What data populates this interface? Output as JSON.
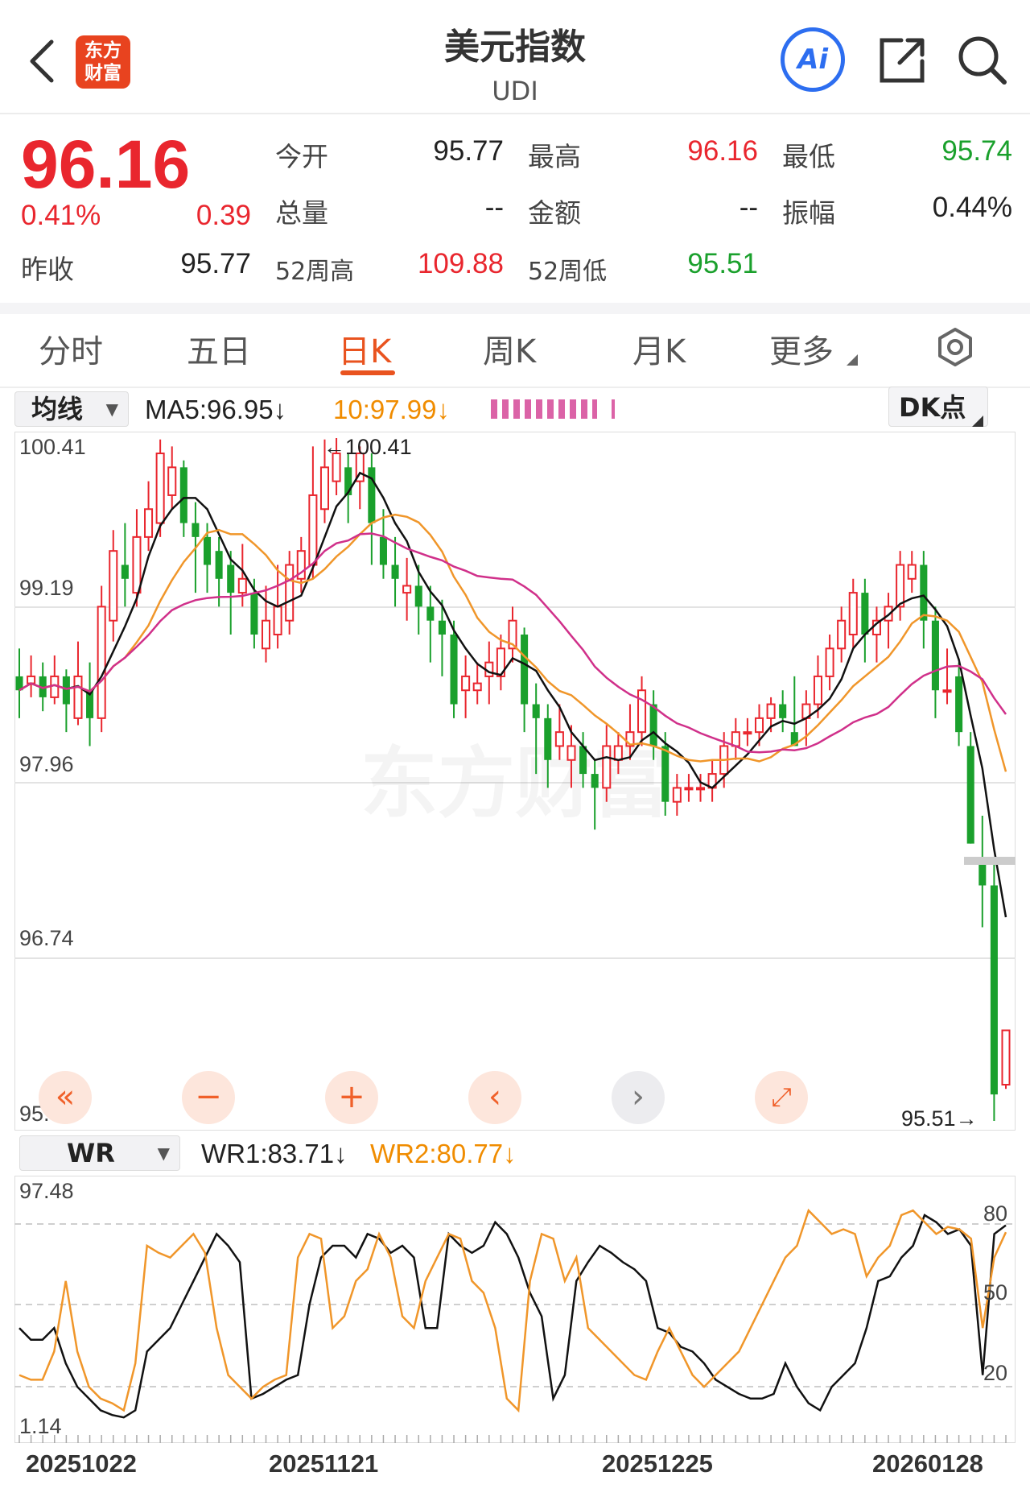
{
  "header": {
    "title": "美元指数",
    "subtitle": "UDI",
    "logo_text_1": "东方",
    "logo_text_2": "财富",
    "ai_label": "Ai"
  },
  "quote": {
    "price": "96.16",
    "change_pct": "0.41%",
    "change": "0.39",
    "prev_close_label": "昨收",
    "prev_close": "95.77",
    "open_label": "今开",
    "open": "95.77",
    "high_label": "最高",
    "high": "96.16",
    "low_label": "最低",
    "low": "95.74",
    "volume_label": "总量",
    "volume": "--",
    "amount_label": "金额",
    "amount": "--",
    "amplitude_label": "振幅",
    "amplitude": "0.44%",
    "w52_high_label": "52周高",
    "w52_high": "109.88",
    "w52_low_label": "52周低",
    "w52_low": "95.51"
  },
  "tabs": [
    {
      "label": "分时"
    },
    {
      "label": "五日"
    },
    {
      "label": "日K"
    },
    {
      "label": "周K"
    },
    {
      "label": "月K"
    },
    {
      "label": "更多"
    }
  ],
  "main_indicator": {
    "selector": "均线",
    "ma5": "MA5:96.95↓",
    "ma10": "10:97.99↓",
    "dk_button": "DK点"
  },
  "main_axis": {
    "ticks": [
      "100.41",
      "99.19",
      "97.96",
      "96.74",
      "95.51"
    ],
    "max_marker": "←100.41",
    "min_marker": "95.51→"
  },
  "sub_indicator": {
    "selector": "WR",
    "wr1": "WR1:83.71↓",
    "wr2": "WR2:80.77↓",
    "axis_top": "97.48",
    "axis_bottom": "1.14",
    "levels": [
      "80",
      "50",
      "20"
    ]
  },
  "dates": [
    "20251022",
    "20251121",
    "20251225",
    "20260128"
  ],
  "colors": {
    "up": "#e9262e",
    "down": "#1aa02c",
    "accent": "#e9531f",
    "ma5": "#111111",
    "ma10": "#f0962a",
    "ma20": "#d0308a"
  },
  "chart_data": {
    "type": "candlestick",
    "ylim": [
      95.51,
      100.41
    ],
    "candles": [
      [
        98.7,
        98.6,
        98.9,
        98.4
      ],
      [
        98.65,
        98.7,
        98.85,
        98.55
      ],
      [
        98.7,
        98.55,
        98.8,
        98.45
      ],
      [
        98.55,
        98.7,
        98.85,
        98.5
      ],
      [
        98.7,
        98.5,
        98.75,
        98.3
      ],
      [
        98.4,
        98.7,
        98.95,
        98.35
      ],
      [
        98.6,
        98.4,
        98.8,
        98.2
      ],
      [
        98.4,
        99.2,
        99.35,
        98.3
      ],
      [
        99.1,
        99.6,
        99.75,
        98.95
      ],
      [
        99.5,
        99.4,
        99.8,
        99.2
      ],
      [
        99.3,
        99.7,
        99.9,
        99.2
      ],
      [
        99.7,
        99.9,
        100.1,
        99.6
      ],
      [
        99.8,
        100.3,
        100.4,
        99.7
      ],
      [
        100.0,
        100.2,
        100.35,
        99.9
      ],
      [
        100.2,
        99.8,
        100.25,
        99.7
      ],
      [
        99.8,
        99.7,
        99.95,
        99.3
      ],
      [
        99.7,
        99.5,
        99.8,
        99.3
      ],
      [
        99.6,
        99.4,
        99.7,
        99.2
      ],
      [
        99.5,
        99.3,
        99.6,
        99.0
      ],
      [
        99.3,
        99.4,
        99.65,
        99.2
      ],
      [
        99.3,
        99.0,
        99.4,
        98.9
      ],
      [
        98.9,
        99.1,
        99.35,
        98.8
      ],
      [
        99.0,
        99.2,
        99.5,
        98.9
      ],
      [
        99.1,
        99.5,
        99.6,
        99.0
      ],
      [
        99.4,
        99.6,
        99.7,
        99.3
      ],
      [
        99.5,
        100.0,
        100.35,
        99.4
      ],
      [
        99.9,
        100.2,
        100.4,
        99.8
      ],
      [
        100.1,
        100.3,
        100.41,
        100.0
      ],
      [
        100.2,
        100.0,
        100.3,
        99.8
      ],
      [
        100.1,
        100.3,
        100.35,
        99.9
      ],
      [
        100.2,
        99.8,
        100.3,
        99.5
      ],
      [
        99.7,
        99.5,
        99.9,
        99.4
      ],
      [
        99.5,
        99.4,
        99.7,
        99.2
      ],
      [
        99.3,
        99.35,
        99.55,
        99.1
      ],
      [
        99.35,
        99.2,
        99.5,
        99.0
      ],
      [
        99.2,
        99.1,
        99.35,
        98.8
      ],
      [
        99.1,
        99.0,
        99.25,
        98.7
      ],
      [
        99.0,
        98.5,
        99.1,
        98.4
      ],
      [
        98.6,
        98.7,
        98.85,
        98.4
      ],
      [
        98.6,
        98.65,
        98.8,
        98.5
      ],
      [
        98.7,
        98.8,
        98.95,
        98.5
      ],
      [
        98.7,
        98.9,
        99.0,
        98.6
      ],
      [
        98.9,
        99.1,
        99.2,
        98.8
      ],
      [
        99.0,
        98.5,
        99.05,
        98.3
      ],
      [
        98.5,
        98.4,
        98.65,
        98.0
      ],
      [
        98.4,
        98.1,
        98.5,
        97.9
      ],
      [
        98.2,
        98.3,
        98.5,
        98.1
      ],
      [
        98.1,
        98.2,
        98.35,
        97.9
      ],
      [
        98.2,
        98.0,
        98.3,
        97.9
      ],
      [
        98.0,
        97.9,
        98.1,
        97.6
      ],
      [
        97.9,
        98.2,
        98.35,
        97.8
      ],
      [
        98.1,
        98.2,
        98.3,
        98.0
      ],
      [
        98.2,
        98.3,
        98.5,
        98.1
      ],
      [
        98.3,
        98.6,
        98.7,
        98.2
      ],
      [
        98.5,
        98.2,
        98.6,
        98.1
      ],
      [
        98.2,
        97.8,
        98.3,
        97.7
      ],
      [
        97.8,
        97.9,
        98.0,
        97.7
      ],
      [
        97.9,
        97.9,
        98.0,
        97.8
      ],
      [
        97.9,
        97.9,
        98.0,
        97.8
      ],
      [
        97.9,
        98.0,
        98.1,
        97.8
      ],
      [
        98.0,
        98.2,
        98.3,
        97.9
      ],
      [
        98.2,
        98.3,
        98.4,
        98.1
      ],
      [
        98.3,
        98.3,
        98.4,
        98.2
      ],
      [
        98.3,
        98.4,
        98.5,
        98.2
      ],
      [
        98.4,
        98.5,
        98.55,
        98.3
      ],
      [
        98.5,
        98.4,
        98.6,
        98.3
      ],
      [
        98.3,
        98.2,
        98.7,
        98.2
      ],
      [
        98.4,
        98.5,
        98.6,
        98.2
      ],
      [
        98.5,
        98.7,
        98.85,
        98.4
      ],
      [
        98.7,
        98.9,
        99.0,
        98.6
      ],
      [
        98.9,
        99.1,
        99.2,
        98.8
      ],
      [
        99.0,
        99.3,
        99.4,
        98.9
      ],
      [
        99.3,
        99.0,
        99.4,
        98.8
      ],
      [
        99.0,
        99.1,
        99.2,
        98.8
      ],
      [
        99.1,
        99.2,
        99.3,
        98.9
      ],
      [
        99.2,
        99.5,
        99.6,
        99.1
      ],
      [
        99.4,
        99.5,
        99.6,
        99.3
      ],
      [
        99.5,
        99.1,
        99.6,
        98.9
      ],
      [
        99.1,
        98.6,
        99.2,
        98.4
      ],
      [
        98.6,
        98.6,
        98.9,
        98.5
      ],
      [
        98.7,
        98.3,
        98.8,
        98.2
      ],
      [
        98.2,
        97.5,
        98.3,
        97.5
      ],
      [
        97.4,
        97.2,
        97.7,
        96.9
      ],
      [
        97.2,
        95.7,
        97.4,
        95.51
      ],
      [
        95.77,
        96.16,
        96.16,
        95.74
      ]
    ],
    "wr1": [
      40,
      35,
      35,
      40,
      25,
      15,
      10,
      5,
      3,
      2,
      5,
      30,
      35,
      40,
      50,
      60,
      70,
      80,
      75,
      68,
      10,
      12,
      15,
      18,
      20,
      50,
      70,
      75,
      75,
      70,
      80,
      78,
      72,
      75,
      70,
      40,
      40,
      80,
      75,
      72,
      75,
      85,
      80,
      70,
      55,
      45,
      10,
      20,
      60,
      68,
      75,
      72,
      68,
      65,
      60,
      40,
      38,
      32,
      30,
      25,
      18,
      15,
      12,
      10,
      10,
      12,
      25,
      15,
      8,
      5,
      15,
      20,
      25,
      40,
      60,
      62,
      70,
      75,
      88,
      85,
      80,
      82,
      75,
      20,
      80,
      83.71
    ],
    "wr2": [
      20,
      18,
      18,
      30,
      60,
      30,
      15,
      10,
      8,
      5,
      25,
      75,
      72,
      70,
      75,
      80,
      72,
      40,
      20,
      15,
      10,
      15,
      18,
      20,
      70,
      80,
      78,
      40,
      45,
      60,
      65,
      80,
      70,
      45,
      40,
      60,
      70,
      80,
      78,
      60,
      55,
      40,
      10,
      5,
      60,
      80,
      78,
      60,
      70,
      40,
      35,
      30,
      25,
      20,
      18,
      30,
      40,
      30,
      20,
      15,
      20,
      25,
      30,
      40,
      50,
      60,
      70,
      75,
      90,
      85,
      80,
      82,
      80,
      62,
      70,
      75,
      88,
      90,
      85,
      80,
      83,
      82,
      78,
      40,
      70,
      80.77
    ]
  }
}
